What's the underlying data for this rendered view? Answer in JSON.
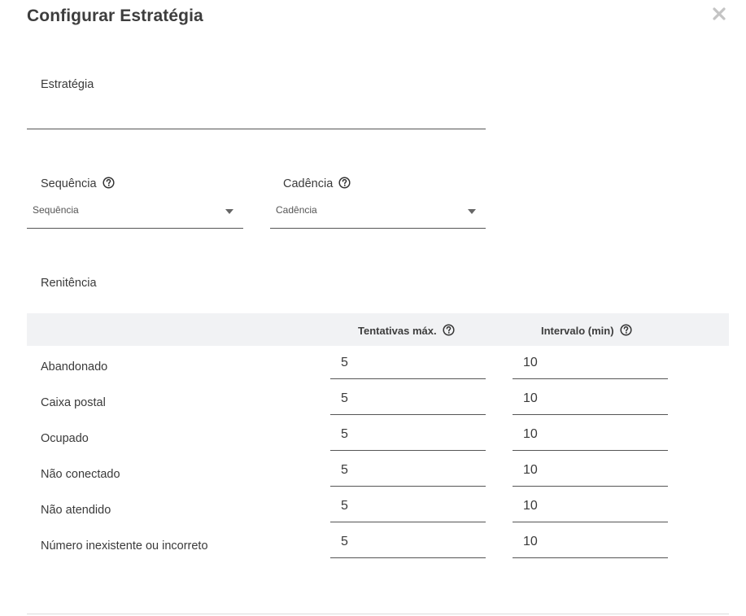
{
  "dialog": {
    "title": "Configurar Estratégia"
  },
  "strategy": {
    "label": "Estratégia",
    "value": ""
  },
  "sequence": {
    "label": "Sequência",
    "placeholder": "Sequência"
  },
  "cadence": {
    "label": "Cadência",
    "placeholder": "Cadência"
  },
  "renitencia": {
    "label": "Renitência",
    "columns": {
      "max_attempts": "Tentativas máx.",
      "interval": "Intervalo (min)"
    },
    "rows": [
      {
        "label": "Abandonado",
        "max_attempts": "5",
        "interval": "10"
      },
      {
        "label": "Caixa postal",
        "max_attempts": "5",
        "interval": "10"
      },
      {
        "label": "Ocupado",
        "max_attempts": "5",
        "interval": "10"
      },
      {
        "label": "Não conectado",
        "max_attempts": "5",
        "interval": "10"
      },
      {
        "label": "Não atendido",
        "max_attempts": "5",
        "interval": "10"
      },
      {
        "label": "Número inexistente ou incorreto",
        "max_attempts": "5",
        "interval": "10"
      }
    ]
  },
  "icons": {
    "close": "close-icon",
    "help": "help-circle-icon",
    "dropdown": "chevron-down-icon"
  },
  "colors": {
    "header_bg": "#f1f2f4",
    "text": "#3a3a3a",
    "underline": "#555555"
  }
}
